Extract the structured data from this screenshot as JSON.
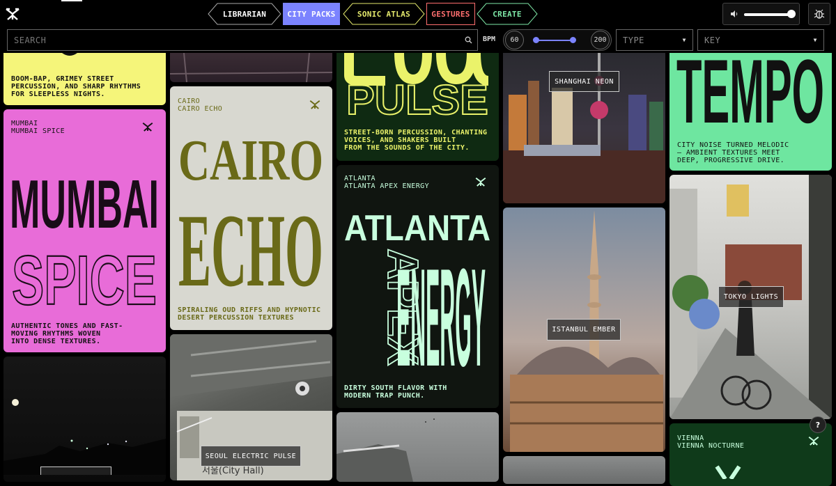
{
  "nav": {
    "tabs": [
      {
        "label": "LIBRARIAN"
      },
      {
        "label": "CITY PACKS"
      },
      {
        "label": "SONIC ATLAS"
      },
      {
        "label": "GESTURES"
      },
      {
        "label": "CREATE"
      }
    ]
  },
  "filters": {
    "search_placeholder": "SEARCH",
    "bpm_label": "BPM",
    "bpm_min": "60",
    "bpm_max": "200",
    "type_label": "TYPE",
    "key_label": "KEY"
  },
  "audio": {
    "volume_percent": 90
  },
  "colors": {
    "nav_active_bg": "#7b83ff",
    "sonic_atlas": "#e3e86c",
    "gestures": "#ff6f6f",
    "create": "#7ee8a7",
    "boom_card": "#f5f57a",
    "mumbai_card": "#e86cd8",
    "cairo_card": "#d8d8d0",
    "cairo_ink": "#6a6a18",
    "pulse_card": "#0f2a12",
    "pulse_ink": "#eaf26a",
    "atlanta_card": "#101510",
    "atlanta_ink": "#c8ffde",
    "tempo_card": "#6ee6a0",
    "vienna_card": "#0f3a1a"
  },
  "cards": {
    "boom": {
      "desc": "BOOM-BAP, GRIMEY STREET\nPERCUSSION, AND SHARP RHYTHMS\nFOR SLEEPLESS NIGHTS."
    },
    "mumbai": {
      "city": "MUMBAI",
      "pack": "MUMBAI SPICE",
      "line1": "MUMBAI",
      "line2": "SPICE",
      "desc": "AUTHENTIC TONES AND FAST-\nMOVING RHYTHMS WOVEN\nINTO DENSE TEXTURES."
    },
    "cairo": {
      "city": "CAIRO",
      "pack": "CAIRO ECHO",
      "line1": "CAIRO",
      "line2": "ECHO",
      "desc": "SPIRALING OUD RIFFS AND HYPNOTIC\nDESERT PERCUSSION TEXTURES"
    },
    "pulse": {
      "word": "PULSE",
      "desc": "STREET-BORN PERCUSSION, CHANTING\nVOICES, AND SHAKERS BUILT\nFROM THE SOUNDS OF THE CITY."
    },
    "atlanta": {
      "city": "ATLANTA",
      "pack": "ATLANTA APEX ENERGY",
      "line1": "ATLANTA",
      "line2": "APEX",
      "line3": "ENERGY",
      "desc": "DIRTY SOUTH FLAVOR WITH\nMODERN TRAP PUNCH."
    },
    "tempo": {
      "word": "TEMPO",
      "desc": "CITY NOISE TURNED MELODIC\n– AMBIENT TEXTURES MEET\nDEEP, PROGRESSIVE DRIVE."
    },
    "vienna": {
      "city": "VIENNA",
      "pack": "VIENNA NOCTURNE"
    },
    "shanghai": {
      "label": "SHANGHAI NEON"
    },
    "istanbul": {
      "label": "ISTANBUL EMBER"
    },
    "tokyo": {
      "label": "TOKYO LIGHTS"
    },
    "seoul": {
      "label": "SEOUL ELECTRIC PULSE"
    }
  },
  "help": {
    "label": "?"
  }
}
